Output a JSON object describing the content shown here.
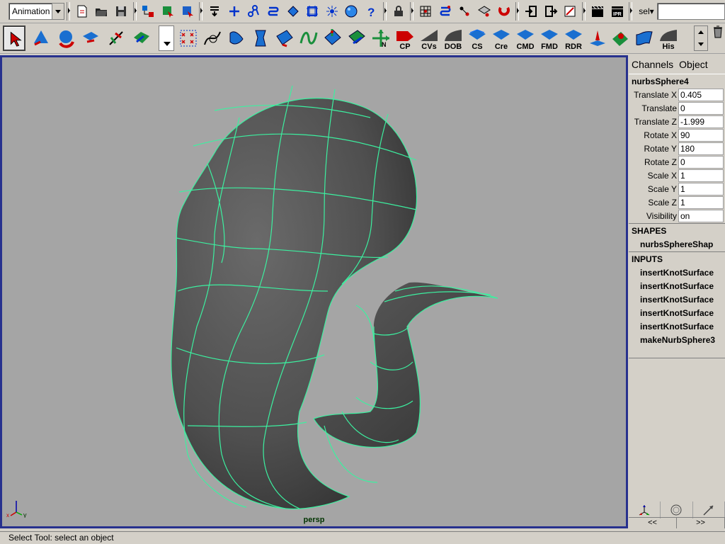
{
  "statusline": {
    "menuset": "Animation",
    "sel_label": "sel▾",
    "sel_value": ""
  },
  "shelf": {
    "buttons": [
      {
        "label": "CP",
        "icon": "cp-shelf-icon"
      },
      {
        "label": "CVs",
        "icon": "cvs-shelf-icon"
      },
      {
        "label": "DOB",
        "icon": "dob-shelf-icon"
      },
      {
        "label": "CS",
        "icon": "cs-shelf-icon"
      },
      {
        "label": "Cre",
        "icon": "cre-shelf-icon"
      },
      {
        "label": "CMD",
        "icon": "cmd-shelf-icon"
      },
      {
        "label": "FMD",
        "icon": "fmd-shelf-icon"
      },
      {
        "label": "RDR",
        "icon": "rdr-shelf-icon"
      },
      {
        "label": "His",
        "icon": "his-shelf-icon"
      }
    ]
  },
  "viewport": {
    "camera": "persp",
    "axis_x": "x",
    "axis_y": "y",
    "background": "#a5a5a5",
    "wire_color": "#3cf0a0",
    "frame_color": "#27318e"
  },
  "channelbox": {
    "menu_channels": "Channels",
    "menu_object": "Object",
    "object_name": "nurbsSphere4",
    "attributes": [
      {
        "label": "Translate X",
        "value": "0.405"
      },
      {
        "label": "Translate",
        "value": "0"
      },
      {
        "label": "Translate Z",
        "value": "-1.999"
      },
      {
        "label": "Rotate X",
        "value": "90"
      },
      {
        "label": "Rotate Y",
        "value": "180"
      },
      {
        "label": "Rotate Z",
        "value": "0"
      },
      {
        "label": "Scale X",
        "value": "1"
      },
      {
        "label": "Scale Y",
        "value": "1"
      },
      {
        "label": "Scale Z",
        "value": "1"
      },
      {
        "label": "Visibility",
        "value": "on"
      }
    ],
    "shapes_header": "SHAPES",
    "shapes": [
      "nurbsSphereShap"
    ],
    "inputs_header": "INPUTS",
    "inputs": [
      "insertKnotSurface",
      "insertKnotSurface",
      "insertKnotSurface",
      "insertKnotSurface",
      "insertKnotSurface",
      "makeNurbSphere3"
    ],
    "nav_prev": "<<",
    "nav_next": ">>"
  },
  "helpline": {
    "text": "Select Tool: select an object"
  }
}
